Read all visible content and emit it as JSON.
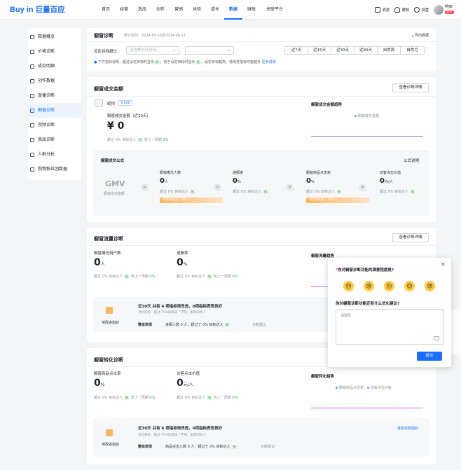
{
  "app": {
    "logo": "Buy in",
    "logo_cn": "巨量百应"
  },
  "nav": [
    "首页",
    "经营",
    "选品",
    "创作",
    "营销",
    "体验",
    "成长",
    "数据",
    "财账",
    "关联平台"
  ],
  "topright": {
    "msg": "消息",
    "notice": "通知",
    "settings": "设置",
    "user": "啊咖！",
    "badge": "达人"
  },
  "sidebar": [
    "数据概览",
    "价格诊断",
    "成交明细",
    "创作数据",
    "直播诊断",
    "橱窗诊断",
    "视频诊断",
    "商品诊断",
    "人群分析",
    "购物粉丝团数据"
  ],
  "diag": {
    "title": "橱窗诊断",
    "stat_time": "统计时间：2024-05-16至2024-06-17",
    "export": "导出数据",
    "compare_label": "设定目标超过",
    "select_placeholder": "请选择对比目标",
    "periods": [
      "近7天",
      "近15天",
      "近30天",
      "近90天",
      "自然周",
      "自然月"
    ],
    "info": "下方指标说明：超过设定目标时显示",
    "info_tag": "高",
    "info2": "；低于设定目标时显示",
    "info_tag2": "低",
    "info3": "；设定目标越高，待改进指标可能越多",
    "more": "更多说明"
  },
  "gmv_panel": {
    "title": "橱窗成交金额",
    "btn": "查看诊断详情",
    "nick": "昵称",
    "level": "LV0",
    "metric_label": "橱窗成交金额（近30天）",
    "value": "¥ 0",
    "sub": "超过 0% 目标达人",
    "sub_tag": "低",
    "sub2": "较上一周期",
    "sub3": "0%",
    "trend_title": "橱窗成交金额趋势",
    "legend": "橱窗成交金额",
    "formula": {
      "title": "橱窗成交公式",
      "link": "公式说明",
      "gmv": "GMV",
      "gmv_sub": "橱窗成交金额",
      "items": [
        {
          "label": "橱窗曝光人数",
          "value": "0",
          "unit": "人",
          "sub": "超过 0% 目标达人",
          "tag": "低",
          "bar": "待改进指标：4项 >"
        },
        {
          "label": "进橱率",
          "value": "0",
          "unit": "%",
          "sub": "超过 0% 目标达人",
          "tag": "低"
        },
        {
          "label": "橱窗商品点击率",
          "value": "0",
          "unit": "%",
          "sub": "超过 0% 目标达人",
          "tag": "低",
          "bar": "待改进指标：6项 >"
        },
        {
          "label": "访客点击价值",
          "value": "0",
          "unit": "元/人",
          "sub": "超过 0% 目标达人",
          "tag": "低"
        }
      ]
    }
  },
  "flow_panel": {
    "title": "橱窗流量诊断",
    "btn": "查看诊断详情",
    "m1_label": "橱窗曝光用户数",
    "m1_value": "0",
    "m1_unit": "人",
    "m2_label": "进橱率",
    "m2_value": "0",
    "m2_unit": "%",
    "sub": "超过 0% 目标达人",
    "tag": "低",
    "sub2": "较上一周期",
    "sub3": "0%",
    "trend": "橱窗流量趋势",
    "box": {
      "icon_label": "待改进指标",
      "headline": "近30天 共有 4 项指标待改进，0项指标表现良好",
      "note": "对比目标：超过 75%同等级「不限」类目的达人",
      "perf_label": "整体表现",
      "perf": "进橱人数 0 人，超过了 0% 目标达人",
      "tag": "低",
      "diag": "诊断建议"
    }
  },
  "conv_panel": {
    "title": "橱窗转化诊断",
    "m1_label": "橱窗商品点击率",
    "m1_value": "0",
    "m1_unit": "%",
    "m2_label": "访客点击价值",
    "m2_value": "0",
    "m2_unit": "元/人",
    "sub": "超过 0% 目标达人",
    "tag": "低",
    "sub2": "较上一周期",
    "sub3": "0%",
    "trend": "橱窗转化趋势",
    "leg1": "橱窗商品点击率",
    "leg2": "访客点击价值",
    "box": {
      "icon_label": "待改进指标",
      "headline": "近30天 共有 6 项指标待改进，0项指标表现良好",
      "note": "对比目标：超过 75%同等级「不限」类目的达人",
      "perf_label": "整体表现",
      "perf": "商品点击人数 0 人，超过了 0% 目标达人",
      "tag": "低",
      "diag": "诊断建议",
      "all": "查看全部指标"
    }
  },
  "survey": {
    "q1": "你对橱窗诊断功能的满意程度是?",
    "q2": "你对橱窗诊断功能还有什么优化建议?",
    "placeholder": "请填写",
    "submit": "提交"
  },
  "colors": {
    "accent": "#1a6dff",
    "orange": "#ff9f43",
    "purple": "#c86df0"
  }
}
